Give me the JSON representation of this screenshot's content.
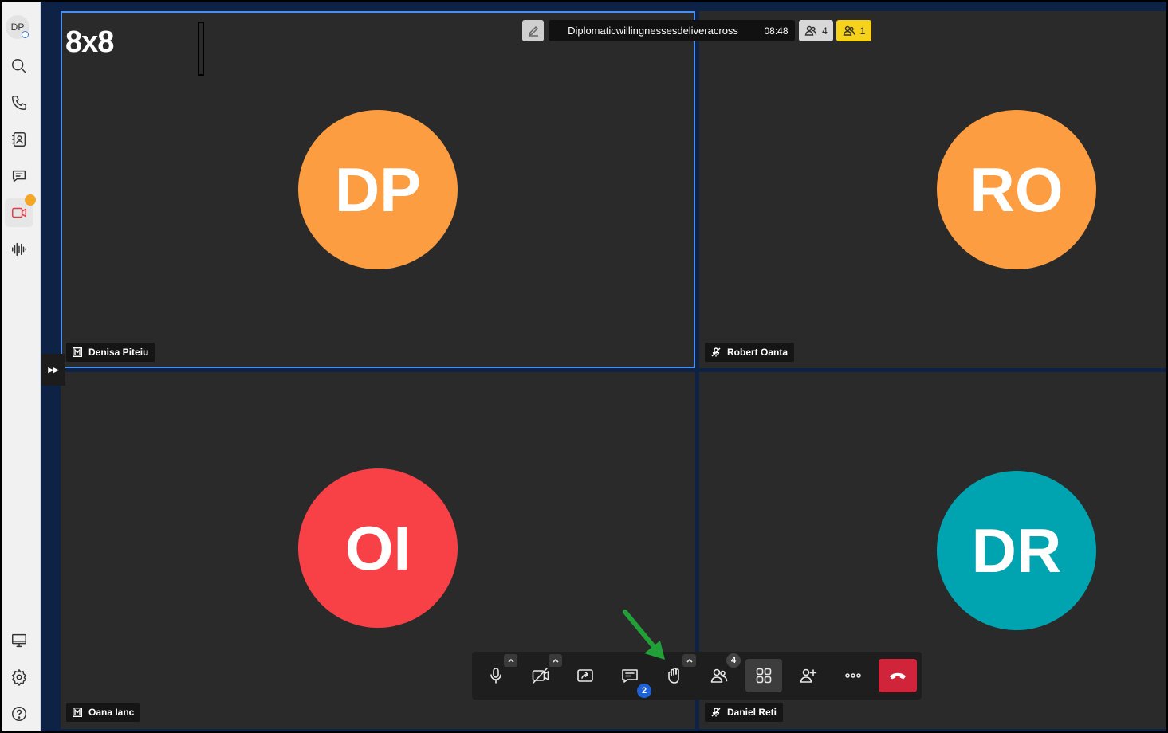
{
  "app": {
    "logo_text": "8x8"
  },
  "sidebar": {
    "avatar_initials": "DP",
    "items": [
      {
        "name": "search",
        "icon": "search-icon"
      },
      {
        "name": "calls",
        "icon": "phone-icon"
      },
      {
        "name": "contacts",
        "icon": "contacts-icon"
      },
      {
        "name": "chat",
        "icon": "chat-icon"
      },
      {
        "name": "meetings",
        "icon": "video-icon",
        "active": true
      },
      {
        "name": "voice",
        "icon": "waveform-icon"
      }
    ],
    "bottom_items": [
      {
        "name": "desktop",
        "icon": "monitor-icon"
      },
      {
        "name": "settings",
        "icon": "gear-icon"
      },
      {
        "name": "help",
        "icon": "help-icon"
      }
    ]
  },
  "meeting": {
    "title": "Diplomaticwillingnessesdeliveracross",
    "time": "08:48",
    "participants_count": "4",
    "lobby_count": "1"
  },
  "tiles": [
    {
      "initials": "DP",
      "name": "Denisa Piteiu",
      "color": "#fd9d41",
      "badge": "M",
      "active": true
    },
    {
      "initials": "RO",
      "name": "Robert Oanta",
      "color": "#fd9d41",
      "badge": "mic-off"
    },
    {
      "initials": "OI",
      "name": "Oana Ianc",
      "color": "#f74146",
      "badge": "M"
    },
    {
      "initials": "DR",
      "name": "Daniel Reti",
      "color": "#00a4b1",
      "badge": "mic-off"
    }
  ],
  "toolbar": {
    "chat_badge": "2",
    "participants_badge": "4"
  },
  "colors": {
    "accent": "#4a8ef0",
    "hangup": "#d0243a",
    "arrow": "#21a038"
  }
}
